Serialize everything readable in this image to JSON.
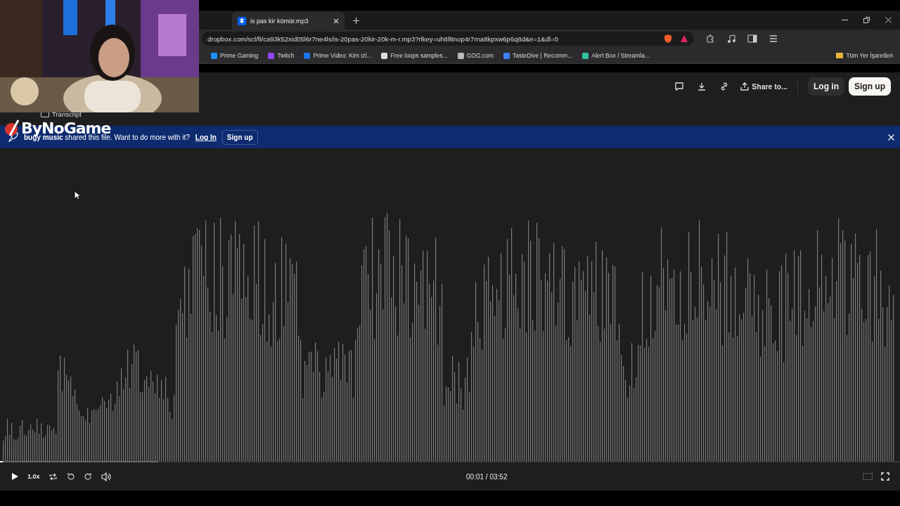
{
  "stream_overlay": {
    "logo": "ByNoGame"
  },
  "browser": {
    "tabs": [
      {
        "title": "is pas kir kömür.mp3",
        "selected": true
      }
    ],
    "address": "dropbox.com/scl/fi/ca93k52xid05l6r7ne4ls/is-20pas-20kir-20k-m-r.mp3?rlkey=uh8f8nop4r7rna8kpxw6p6q8d&e=1&dl=0",
    "bookmarks": [
      {
        "label": "Prime Gaming",
        "color": "#1e90ff"
      },
      {
        "label": "Twitch",
        "color": "#9146ff"
      },
      {
        "label": "Prime Video: Kim izl...",
        "color": "#1a73e8"
      },
      {
        "label": "Free loops samples...",
        "color": "#dddddd"
      },
      {
        "label": "GOG.com",
        "color": "#bbbbbb"
      },
      {
        "label": "TasteDive | Recomm...",
        "color": "#3b82f6"
      },
      {
        "label": "Alert Box / Streamla...",
        "color": "#31c3a2"
      }
    ],
    "all_bookmarks": "Tüm Yer İşaretleri"
  },
  "toolbar": {
    "share": "Share to...",
    "login": "Log in",
    "signup": "Sign up"
  },
  "transcript": "Transcript",
  "banner": {
    "text": "**bugy music** shared this file. Want to do more with it?",
    "login": "Log In",
    "signup": "Sign up"
  },
  "player": {
    "speed": "1.0x",
    "time": "00:01 / 03:52",
    "level": 0.003
  }
}
